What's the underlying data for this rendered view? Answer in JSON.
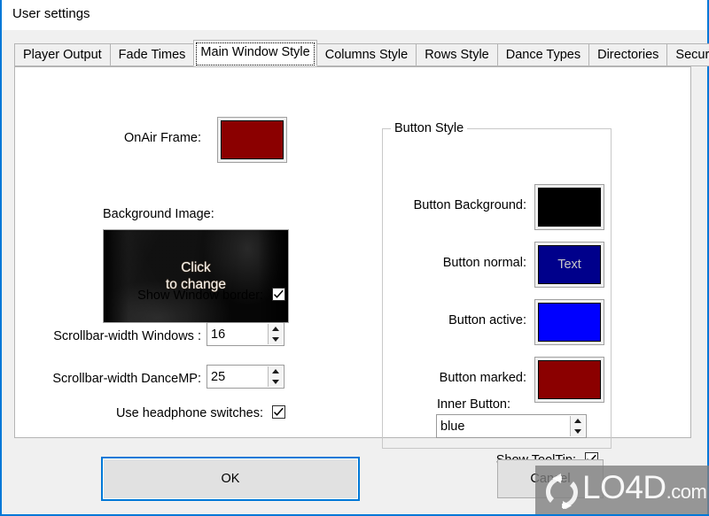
{
  "window": {
    "title": "User settings",
    "accent_color": "#0078d7",
    "dialog_background": "#f0f0f0",
    "panel_background": "#ffffff"
  },
  "tabs": [
    {
      "label": "Player Output",
      "active": false
    },
    {
      "label": "Fade Times",
      "active": false
    },
    {
      "label": "Main Window Style",
      "active": true
    },
    {
      "label": "Columns Style",
      "active": false
    },
    {
      "label": "Rows Style",
      "active": false
    },
    {
      "label": "Dance Types",
      "active": false
    },
    {
      "label": "Directories",
      "active": false
    },
    {
      "label": "Security",
      "active": false
    }
  ],
  "left_panel": {
    "onair_frame": {
      "label": "OnAir Frame:",
      "color": "#8b0000"
    },
    "background_image": {
      "label": "Background Image:",
      "caption_line1": "Click",
      "caption_line2": "to change"
    },
    "show_window_border": {
      "label": "Show Window border:",
      "checked": true
    },
    "scrollbar_width_windows": {
      "label": "Scrollbar-width Windows :",
      "value": "16"
    },
    "scrollbar_width_dancemp": {
      "label": "Scrollbar-width DanceMP:",
      "value": "25"
    },
    "use_headphone_switches": {
      "label": "Use headphone switches:",
      "checked": true
    }
  },
  "button_style": {
    "title": "Button Style",
    "button_background": {
      "label": "Button Background:",
      "color": "#000000"
    },
    "button_normal": {
      "label": "Button normal:",
      "color": "#00008b",
      "sample_text": "Text",
      "sample_text_color": "#c8c8c8"
    },
    "button_active": {
      "label": "Button active:",
      "color": "#0000ff"
    },
    "button_marked": {
      "label": "Button marked:",
      "color": "#8b0000"
    },
    "inner_button": {
      "label": "Inner Button:",
      "value": "blue"
    },
    "show_tooltip": {
      "label": "Show ToolTip:",
      "checked": true
    }
  },
  "footer": {
    "ok_label": "OK",
    "cancel_label": "Cancel"
  },
  "watermark": {
    "text": "LO4D",
    "suffix": ".com",
    "icon": "refresh-arrows-icon"
  }
}
